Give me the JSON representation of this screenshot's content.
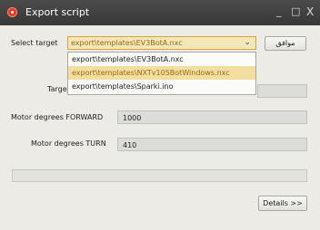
{
  "window": {
    "title": "Export script",
    "minimize": "_",
    "maximize": "□",
    "close": "X"
  },
  "form": {
    "select_target_label": "Select target",
    "selected_target": "export\\templates\\EV3BotA.nxc",
    "confirm_button": "موافق",
    "target_label_partial": "Targe",
    "motor_forward_label": "Motor degrees FORWARD",
    "motor_forward_value": "1000",
    "motor_turn_label": "Motor degrees TURN",
    "motor_turn_value": "410"
  },
  "dropdown": {
    "options": [
      "export\\templates\\EV3BotA.nxc",
      "export\\templates\\NXTv105BotWindows.nxc",
      "export\\templates\\Sparki.ino"
    ],
    "highlighted_index": 1
  },
  "progress": {
    "value": 0
  },
  "footer": {
    "details_button": "Details >>"
  },
  "colors": {
    "titlebar": "#3f3f3f",
    "highlight": "#f2dea0",
    "accent_text": "#9a6a10",
    "app_icon": "#e23b2a"
  }
}
